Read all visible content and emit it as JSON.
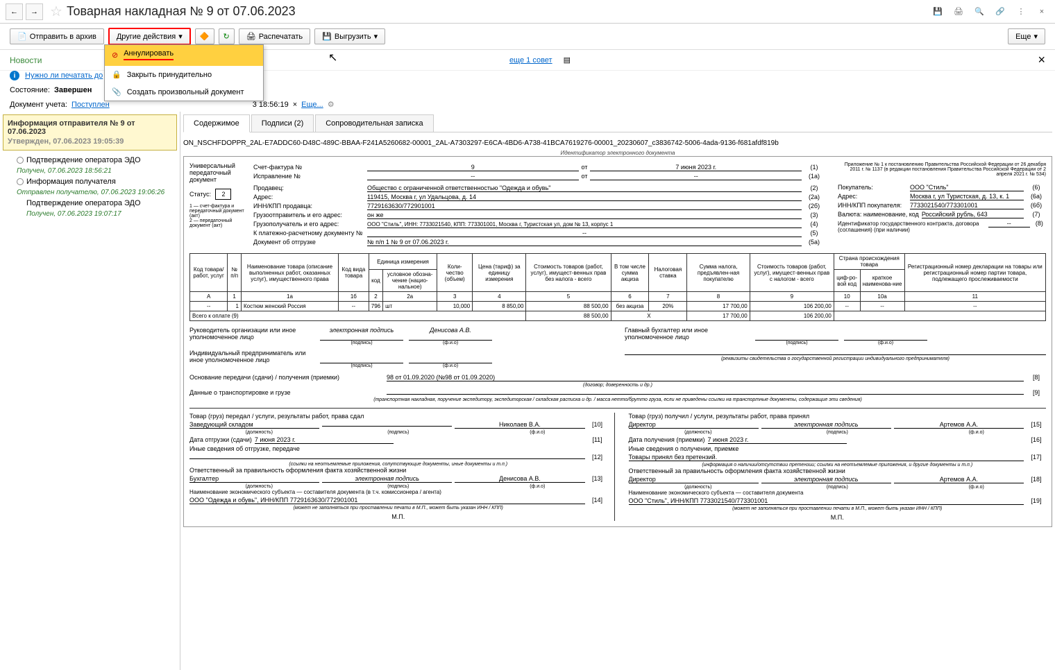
{
  "header": {
    "title": "Товарная накладная № 9 от 07.06.2023"
  },
  "toolbar": {
    "send_archive": "Отправить в архив",
    "other_actions": "Другие действия",
    "print": "Распечатать",
    "upload": "Выгрузить",
    "more": "Еще"
  },
  "dropdown": {
    "annul": "Аннулировать",
    "force_close": "Закрыть принудительно",
    "create_doc": "Создать произвольный документ"
  },
  "news": {
    "label": "Новости",
    "link": "Нужно ли печатать до",
    "advice": "еще 1 совет"
  },
  "state": {
    "label": "Состояние:",
    "value": "Завершен"
  },
  "doc": {
    "label": "Документ учета:",
    "link": "Поступлен",
    "time": "3 18:56:19",
    "more": "Еще..."
  },
  "left": {
    "info_title": "Информация отправителя № 9 от 07.06.2023",
    "info_status": "Утвержден, 07.06.2023 19:05:39",
    "item1": "Подтверждение оператора ЭДО",
    "item1_sub": "Получен, 07.06.2023 18:56:21",
    "item2": "Информация получателя",
    "item2_sub": "Отправлен получателю, 07.06.2023 19:06:26",
    "item3": "Подтверждение оператора ЭДО",
    "item3_sub": "Получен, 07.06.2023 19:07:17"
  },
  "tabs": {
    "content": "Содержимое",
    "signatures": "Подписи (2)",
    "note": "Сопроводительная записка"
  },
  "document": {
    "id": "ON_NSCHFDOPPR_2AL-E7ADDC60-D48C-489C-BBAA-F241A5260682-00001_2AL-A7303297-E6CA-4BD6-A738-41BCA7619276-00001_20230607_c3836742-5006-4ada-9136-f681afdf819b",
    "id_label": "Идентификатор электронного документа",
    "upd_label": "Универсальный передаточный документ",
    "status_label": "Статус:",
    "status_val": "2",
    "footnote": "1 — счет-фактура и передаточный документ (акт)\n2 — передаточный документ (акт)",
    "invoice_label": "Счет-фактура №",
    "invoice_num": "9",
    "from": "от",
    "invoice_date": "7 июня 2023 г.",
    "correction_label": "Исправление №",
    "correction_num": "--",
    "correction_date": "--",
    "appendix": "Приложение № 1 к постановлению Правительства Российской Федерации от 26 декабря 2011 г. № 1137 (в редакции постановления Правительства Российской Федерации от 2 апреля 2021 г. № 534)",
    "seller_label": "Продавец:",
    "seller": "Общество с ограниченной ответственностью \"Одежда и обувь\"",
    "address_label": "Адрес:",
    "seller_address": "119415, Москва г, ул Удальцова, д. 14",
    "inn_label": "ИНН/КПП продавца:",
    "seller_inn": "7729163630/772901001",
    "shipper_label": "Грузоотправитель и его адрес:",
    "shipper": "он же",
    "consignee_label": "Грузополучатель и его адрес:",
    "consignee": "ООО \"Стиль\", ИНН: 7733021540, КПП: 773301001, Москва г, Туристская ул, дом № 13, корпус 1",
    "payment_label": "К платежно-расчетному документу №",
    "payment": "--",
    "shipment_label": "Документ об отгрузке",
    "shipment": "№ п/п 1 № 9 от 07.06.2023 г.",
    "buyer_label": "Покупатель:",
    "buyer": "ООО \"Стиль\"",
    "buyer_address": "Москва г, ул Туристская, д. 13, к. 1",
    "buyer_inn_label": "ИНН/КПП покупателя:",
    "buyer_inn": "7733021540/773301001",
    "currency_label": "Валюта: наименование, код",
    "currency": "Российский рубль, 643",
    "contract_label": "Идентификатор государственного контракта, договора (соглашения) (при наличии)",
    "contract": "--",
    "table_headers": {
      "code": "Код товара/ работ, услуг",
      "num": "№ п/п",
      "name": "Наименование товара (описание выполненных работ, оказанных услуг), имущественного права",
      "type_code": "Код вида товара",
      "unit": "Единица измерения",
      "unit_code": "код",
      "unit_name": "условное обозна-чение (нацио-нальное)",
      "qty": "Коли-чество (объем)",
      "price": "Цена (тариф) за единицу измерения",
      "cost_no_tax": "Стоимость товаров (работ, услуг), имущест-венных прав без налога - всего",
      "excise": "В том числе сумма акциза",
      "tax_rate": "Налоговая ставка",
      "tax_sum": "Сумма налога, предъявлен-ная покупателю",
      "cost_with_tax": "Стоимость товаров (работ, услуг), имущест-венных прав с налогом - всего",
      "country": "Страна происхождения товара",
      "country_code": "циф-ро-вой код",
      "country_name": "краткое наименова-ние",
      "reg_num": "Регистрационный номер декларации на товары или регистрационный номер партии товара, подлежащего прослеживаемости"
    },
    "col_nums": [
      "А",
      "1",
      "1а",
      "1б",
      "2",
      "2а",
      "3",
      "4",
      "5",
      "6",
      "7",
      "8",
      "9",
      "10",
      "10а",
      "11"
    ],
    "row": {
      "code": "--",
      "num": "1",
      "name": "Костюм женский Россия",
      "type": "--",
      "unit_code": "796",
      "unit_name": "шт",
      "qty": "10,000",
      "price": "8 850,00",
      "cost_no_tax": "88 500,00",
      "excise": "без акциза",
      "tax_rate": "20%",
      "tax_sum": "17 700,00",
      "cost_with_tax": "106 200,00",
      "cc": "--",
      "cn": "--",
      "reg": "--"
    },
    "total_label": "Всего к оплате (9)",
    "total1": "88 500,00",
    "total_x": "Х",
    "total2": "17 700,00",
    "total3": "106 200,00",
    "sig_left_role": "Руководитель организации или иное уполномоченное лицо",
    "sig_esign": "электронная подпись",
    "sig_denisova": "Денисова А.В.",
    "sig_right_role": "Главный бухгалтер или иное уполномоченное лицо",
    "sig_ip": "Индивидуальный предприниматель или иное уполномоченное лицо",
    "basis_label": "Основание передачи (сдачи) / получения (приемки)",
    "basis": "98 от 01.09.2020 (№98 от 01.09.2020)",
    "transport_label": "Данные о транспортировке и грузе",
    "transfer_left": "Товар (груз) передал / услуги, результаты работ, права сдал",
    "transfer_right": "Товар (груз) получил / услуги, результаты работ, права принял",
    "warehouse": "Заведующий складом",
    "nikolaev": "Николаев В.А.",
    "director": "Директор",
    "artemov": "Артемов А.А.",
    "ship_date_label": "Дата отгрузки (сдачи)",
    "ship_date": "7 июня 2023 г.",
    "receive_date_label": "Дата получения (приемки)",
    "receive_date": "7 июня 2023 г.",
    "other_ship": "Иные сведения об отгрузке, передаче",
    "other_receive": "Иные сведения о получении, приемке",
    "no_claims": "Товары принял без претензий.",
    "responsible": "Ответственный за правильность оформления факта хозяйственной жизни",
    "accountant": "Бухгалтер",
    "entity_label_l": "Наименование экономического субъекта — составителя документа (в т.ч. комиссионера / агента)",
    "entity_label_r": "Наименование экономического субъекта — составителя документа",
    "entity_l": "ООО \"Одежда и обувь\", ИНН/КПП 7729163630/772901001",
    "entity_r": "ООО \"Стиль\", ИНН/КПП 7733021540/773301001",
    "mp": "М.П.",
    "podpis": "(подпись)",
    "fio": "(ф.и.о)",
    "dolzhnost": "(должность)",
    "rekvizity": "(реквизиты свидетельства о государственной регистрации индивидуального предпринимателя)",
    "dogovor": "(договор; доверенность и др.)",
    "transport_note": "(транспортная накладная, поручение экспедитору, экспедиторская / складская расписка и др. / масса нетто/брутто груза, если не приведены ссылки на транспортные документы, содержащие эти сведения)",
    "mp_note": "(может не заполняться при проставлении печати в М.П., может быть указан ИНН / КПП)",
    "ssylki": "(ссылки на неотъемлемые приложения, сопутствующие документы, иные документы и т.п.)",
    "info_note": "(информация о наличии/отсутствии претензии; ссылки на неотъемлемые приложения, и другие документы и т.п.)"
  }
}
